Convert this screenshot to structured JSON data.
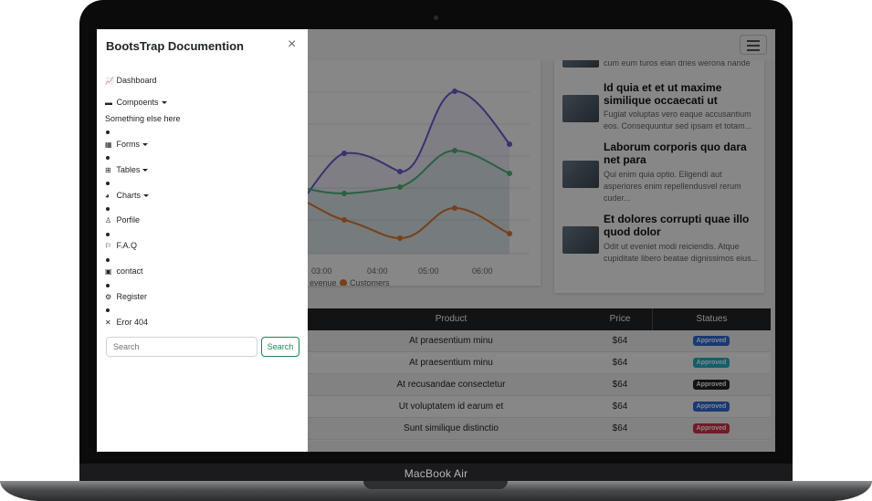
{
  "device": {
    "brand": "MacBook Air"
  },
  "offcanvas": {
    "title": "BootsTrap Documention",
    "close": "×",
    "items": [
      {
        "label": "Dashboard",
        "icon": "📈"
      },
      {
        "label": "Compoents",
        "icon": "▬"
      },
      {
        "label": "Something else here",
        "icon": ""
      },
      {
        "label": "Forms",
        "icon": "▦"
      },
      {
        "label": "Tables",
        "icon": "⊞"
      },
      {
        "label": "Charts",
        "icon": "◕"
      },
      {
        "label": "Porfile",
        "icon": "♙"
      },
      {
        "label": "F.A.Q",
        "icon": "⚐"
      },
      {
        "label": "contact",
        "icon": "▣"
      },
      {
        "label": "Register",
        "icon": "⚙"
      },
      {
        "label": "Eror 404",
        "icon": "✕"
      }
    ],
    "search": {
      "placeholder": "Search",
      "button": "Search"
    }
  },
  "chart": {
    "x_ticks": [
      "03:00",
      "04:00",
      "05:00",
      "06:00"
    ],
    "legend": [
      "evenue",
      "Customers"
    ],
    "colors": {
      "purple": "#6a5fd1",
      "green": "#4fb77a",
      "orange": "#e07a34"
    }
  },
  "news": [
    {
      "title": "",
      "body": "cum eum turos elan dries werona nande"
    },
    {
      "title": "Id quia et et ut maxime similique occaecati ut",
      "body": "Fugiat voluptas vero eaque accusantium eos. Consequuntur sed ipsam et totam..."
    },
    {
      "title": "Laborum corporis quo dara net para",
      "body": "Qui enim quia optio. Eligendi aut asperiores enim repellendusvel rerum cuder..."
    },
    {
      "title": "Et dolores corrupti quae illo quod dolor",
      "body": "Odit ut eveniet modi reiciendis. Atque cupiditate libero beatae dignissimos eius..."
    }
  ],
  "table": {
    "headers": [
      "Product",
      "Price",
      "Statues"
    ],
    "rows": [
      {
        "product": "At praesentium minu",
        "price": "$64",
        "status": "Approved",
        "color": "#2f6fdd"
      },
      {
        "product": "At praesentium minu",
        "price": "$64",
        "status": "Approved",
        "color": "#20b5c8"
      },
      {
        "product": "At recusandae consectetur",
        "price": "$64",
        "status": "Approved",
        "color": "#212529"
      },
      {
        "product": "Ut voluptatem id earum et",
        "price": "$64",
        "status": "Approved",
        "color": "#2f6fdd"
      },
      {
        "product": "Sunt similique distinctio",
        "price": "$64",
        "status": "Approved",
        "color": "#d9344a"
      }
    ]
  }
}
